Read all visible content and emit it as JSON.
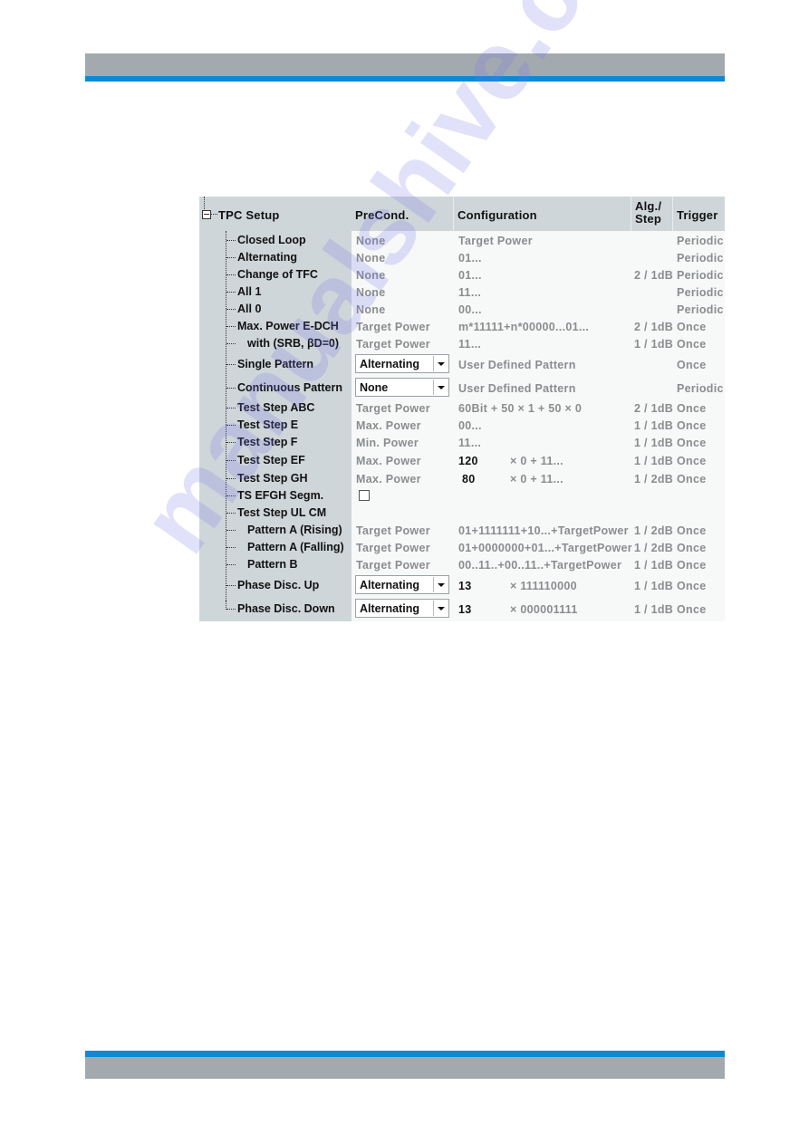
{
  "colors": {
    "band_gray": "#a2aab0",
    "band_blue": "#0d8ad3",
    "tree_bg": "#cfd6da",
    "watermark": "#7878e6"
  },
  "watermark": "manualshive.com",
  "table": {
    "root_label": "TPC Setup",
    "headers": {
      "precond": "PreCond.",
      "configuration": "Configuration",
      "alg_step_line1": "Alg./",
      "alg_step_line2": "Step",
      "trigger": "Trigger"
    },
    "rows": [
      {
        "label": "Closed Loop",
        "precond": "None",
        "config": "Target Power",
        "alg": "",
        "trigger": "Periodic"
      },
      {
        "label": "Alternating",
        "precond": "None",
        "config": "01...",
        "alg": "",
        "trigger": "Periodic"
      },
      {
        "label": "Change of TFC",
        "precond": "None",
        "config": "01...",
        "alg": "2 / 1dB",
        "trigger": "Periodic"
      },
      {
        "label": "All 1",
        "precond": "None",
        "config": "11...",
        "alg": "",
        "trigger": "Periodic"
      },
      {
        "label": "All 0",
        "precond": "None",
        "config": "00...",
        "alg": "",
        "trigger": "Periodic"
      },
      {
        "label": "Max. Power E-DCH",
        "precond": "Target Power",
        "config": "m*11111+n*00000...01...",
        "alg": "2 / 1dB",
        "trigger": "Once"
      },
      {
        "label": "with (SRB, βD=0)",
        "precond": "Target Power",
        "config": "11...",
        "alg": "1 / 1dB",
        "trigger": "Once"
      },
      {
        "label": "Single Pattern",
        "precond_dropdown": "Alternating",
        "config": "User Defined Pattern",
        "alg": "",
        "trigger": "Once"
      },
      {
        "label": "Continuous Pattern",
        "precond_dropdown": "None",
        "config": "User Defined Pattern",
        "alg": "",
        "trigger": "Periodic"
      },
      {
        "label": "Test Step ABC",
        "precond": "Target Power",
        "config": "60Bit + 50 × 1 + 50 × 0",
        "alg": "2 / 1dB",
        "trigger": "Once"
      },
      {
        "label": "Test Step E",
        "precond": "Max. Power",
        "config": "00...",
        "alg": "1 / 1dB",
        "trigger": "Once"
      },
      {
        "label": "Test Step F",
        "precond": "Min. Power",
        "config": "11...",
        "alg": "1 / 1dB",
        "trigger": "Once"
      },
      {
        "label": "Test Step EF",
        "precond": "Max. Power",
        "config_value": "120",
        "config": "× 0 + 11...",
        "alg": "1 / 1dB",
        "trigger": "Once"
      },
      {
        "label": "Test Step GH",
        "precond": "Max. Power",
        "config_value": "80",
        "config": "× 0 + 11...",
        "alg": "1 / 2dB",
        "trigger": "Once"
      },
      {
        "label": "TS EFGH Segm.",
        "checkbox_checked": false
      },
      {
        "label": "Test Step UL CM"
      },
      {
        "label": "Pattern A (Rising)",
        "precond": "Target Power",
        "config": "01+1111111+10...+TargetPower",
        "alg": "1 / 2dB",
        "trigger": "Once"
      },
      {
        "label": "Pattern A (Falling)",
        "precond": "Target Power",
        "config": "01+0000000+01...+TargetPower",
        "alg": "1 / 2dB",
        "trigger": "Once"
      },
      {
        "label": "Pattern B",
        "precond": "Target Power",
        "config": "00..11..+00..11..+TargetPower",
        "alg": "1 / 1dB",
        "trigger": "Once"
      },
      {
        "label": "Phase Disc. Up",
        "precond_dropdown": "Alternating",
        "config_value": "13",
        "config": "× 111110000",
        "alg": "1 / 1dB",
        "trigger": "Once"
      },
      {
        "label": "Phase Disc. Down",
        "precond_dropdown": "Alternating",
        "config_value": "13",
        "config": "× 000001111",
        "alg": "1 / 1dB",
        "trigger": "Once"
      }
    ]
  }
}
